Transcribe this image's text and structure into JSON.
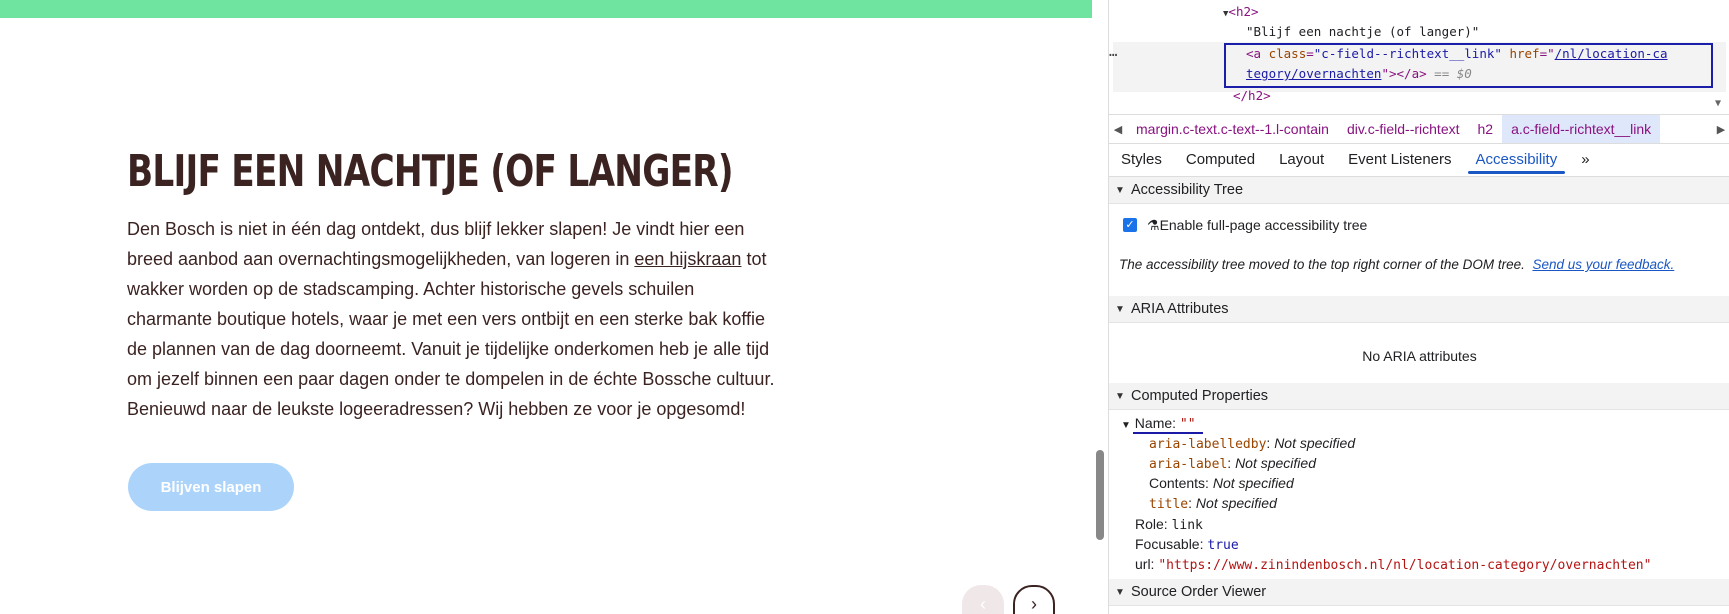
{
  "page": {
    "heading": "BLIJF EEN NACHTJE (OF LANGER)",
    "paragraph_before_link": "Den Bosch is niet in één dag ontdekt, dus blijf lekker slapen! Je vindt hier een breed aanbod aan overnachtingsmogelijkheden, van logeren in ",
    "link_text": "een hijskraan",
    "paragraph_after_link": " tot wakker worden op de stadscamping. Achter historische gevels schuilen charmante boutique hotels, waar je met een vers ontbijt en een sterke bak koffie de plannen van de dag doorneemt. Vanuit je tijdelijke onderkomen heb je alle tijd om jezelf binnen een paar dagen onder te dompelen in de échte Bossche cultuur. Benieuwd naar de leukste logeeradressen? Wij hebben ze voor je opgesomd!",
    "cta_label": "Blijven slapen",
    "prev_glyph": "‹",
    "next_glyph": "›",
    "accent_color": "#6fe4a1"
  },
  "devtools": {
    "dom": {
      "h2_open": "<h2>",
      "text_node": "\"Blijf een nachtje (of langer)\"",
      "a_open": "<a",
      "class_attr": "class",
      "class_val": "\"c-field--richtext__link\"",
      "href_attr": "href",
      "href_val_1": "/nl/location-ca",
      "href_val_2": "tegory/overnachten",
      "a_close": "></a>",
      "eq": "== $0",
      "h2_close": "</h2>",
      "dots": "…"
    },
    "breadcrumbs": [
      "margin.c-text.c-text--1.l-contain",
      "div.c-field--richtext",
      "h2",
      "a.c-field--richtext__link"
    ],
    "tabs": [
      "Styles",
      "Computed",
      "Layout",
      "Event Listeners",
      "Accessibility",
      "»"
    ],
    "active_tab": "Accessibility",
    "sections": {
      "tree": "Accessibility Tree",
      "aria": "ARIA Attributes",
      "computed": "Computed Properties",
      "source": "Source Order Viewer"
    },
    "enable_label": "Enable full-page accessibility tree",
    "moved_note": "The accessibility tree moved to the top right corner of the DOM tree.",
    "feedback_link": "Send us your feedback.",
    "no_aria": "No ARIA attributes",
    "name_label": "Name:",
    "name_value": "\"\"",
    "props": [
      {
        "key": "aria-labelledby",
        "value": "Not specified"
      },
      {
        "key": "aria-label",
        "value": "Not specified"
      },
      {
        "key": "Contents",
        "value": "Not specified"
      },
      {
        "key": "title",
        "value": "Not specified"
      }
    ],
    "role_label": "Role:",
    "role_value": "link",
    "focusable_label": "Focusable:",
    "focusable_value": "true",
    "url_label": "url:",
    "url_value": "\"https://www.zinindenbosch.nl/nl/location-category/overnachten\""
  }
}
